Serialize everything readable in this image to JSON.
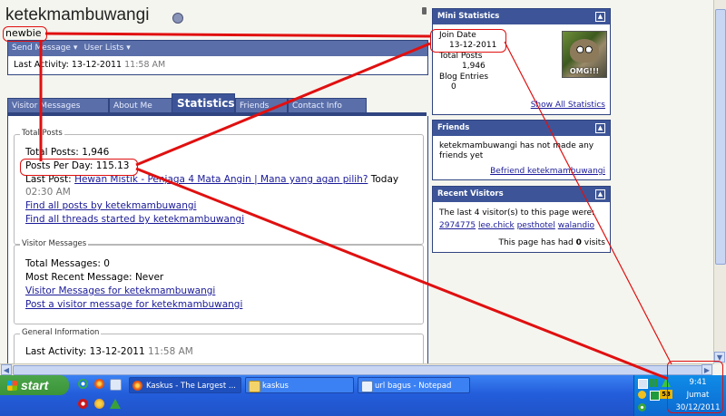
{
  "profile": {
    "username": "ketekmambuwangi",
    "usertitle": "newbie",
    "send_message": "Send Message",
    "user_lists": "User Lists",
    "last_activity_label": "Last Activity:",
    "last_activity_date": "13-12-2011",
    "last_activity_time": "11:58 AM"
  },
  "tabs": [
    {
      "label": "Visitor Messages"
    },
    {
      "label": "About Me"
    },
    {
      "label": "Statistics"
    },
    {
      "label": "Friends"
    },
    {
      "label": "Contact Info"
    }
  ],
  "total_posts": {
    "legend": "Total Posts",
    "total_label": "Total Posts:",
    "total_value": "1,946",
    "per_day_label": "Posts Per Day:",
    "per_day_value": "115.13",
    "last_post_label": "Last Post:",
    "last_post_link": "Hewan Mistik - Penjaga 4 Mata Angin | Mana yang agan pilih?",
    "last_post_day": "Today",
    "last_post_time": "02:30 AM",
    "find_posts": "Find all posts by ketekmambuwangi",
    "find_threads": "Find all threads started by ketekmambuwangi"
  },
  "visitor_messages": {
    "legend": "Visitor Messages",
    "total_label": "Total Messages:",
    "total_value": "0",
    "recent_label": "Most Recent Message:",
    "recent_value": "Never",
    "link_for": "Visitor Messages for ketekmambuwangi",
    "link_post": "Post a visitor message for ketekmambuwangi"
  },
  "general_info": {
    "legend": "General Information",
    "last_activity_label": "Last Activity:",
    "last_activity_date": "13-12-2011",
    "last_activity_time": "11:58 AM"
  },
  "mini_stats": {
    "title": "Mini Statistics",
    "join_label": "Join Date",
    "join_value": "13-12-2011",
    "posts_label": "Total Posts",
    "posts_value": "1,946",
    "blog_label": "Blog Entries",
    "blog_value": "0",
    "avatar_caption": "OMG!!!",
    "show_all": "Show All Statistics"
  },
  "friends": {
    "title": "Friends",
    "text1": "ketekmambuwangi has not made any",
    "text2": "friends yet",
    "befriend": "Befriend ketekmambuwangi"
  },
  "recent_visitors": {
    "title": "Recent Visitors",
    "intro": "The last 4 visitor(s) to this page were:",
    "visitors": [
      "2974775",
      "lee.chick",
      "pesthotel",
      "walandio"
    ],
    "visits_prefix": "This page has had",
    "visits_count": "0",
    "visits_suffix": "visits"
  },
  "taskbar": {
    "start": "start",
    "tasks": [
      {
        "label": "Kaskus - The Largest ..."
      },
      {
        "label": "kaskus"
      },
      {
        "label": "url bagus - Notepad"
      }
    ],
    "clock_time": "9:41",
    "clock_day": "Jumat",
    "clock_date": "30/12/2011",
    "tray_badge": "53"
  },
  "colors": {
    "annotation": "#e01010",
    "header_blue": "#3d5598",
    "taskbar_blue": "#245edb"
  }
}
